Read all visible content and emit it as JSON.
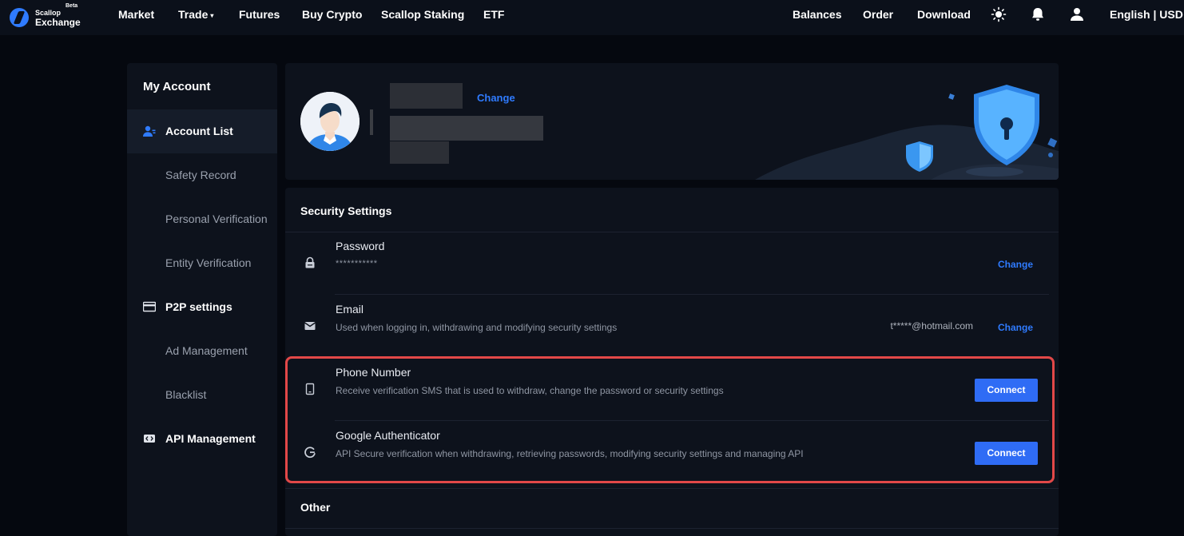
{
  "brand": {
    "name_top": "Scallop",
    "name_main": "Exchange",
    "badge": "Beta"
  },
  "nav": {
    "left": [
      "Market",
      "Trade",
      "Futures",
      "Buy Crypto",
      "Scallop Staking",
      "ETF"
    ],
    "trade_caret": "▾",
    "right": [
      "Balances",
      "Order",
      "Download"
    ],
    "locale": "English | USD",
    "icons": [
      "sun-icon",
      "bell-icon",
      "user-icon"
    ]
  },
  "sidebar": {
    "title": "My Account",
    "items": [
      {
        "label": "Account List",
        "icon": "user-icon",
        "active": true,
        "level": "section"
      },
      {
        "label": "Safety Record",
        "level": "sub"
      },
      {
        "label": "Personal Verification",
        "level": "sub"
      },
      {
        "label": "Entity Verification",
        "level": "sub"
      },
      {
        "label": "P2P settings",
        "icon": "card-icon",
        "level": "section"
      },
      {
        "label": "Ad Management",
        "level": "sub"
      },
      {
        "label": "Blacklist",
        "level": "sub"
      },
      {
        "label": "API Management",
        "icon": "api-icon",
        "level": "section"
      }
    ]
  },
  "profile": {
    "change_label": "Change"
  },
  "security": {
    "title": "Security Settings",
    "rows": [
      {
        "title": "Password",
        "secondary": "***********",
        "icon": "lock-icon",
        "action": "Change"
      },
      {
        "title": "Email",
        "secondary": "Used when logging in, withdrawing and modifying security settings",
        "value": "t*****@hotmail.com",
        "icon": "mail-icon",
        "action": "Change"
      },
      {
        "title": "Phone Number",
        "secondary": "Receive verification SMS that is used to withdraw, change the password or security settings",
        "icon": "phone-icon",
        "action": "Connect"
      },
      {
        "title": "Google Authenticator",
        "secondary": "API Secure verification when withdrawing, retrieving passwords, modifying security settings and managing API",
        "icon": "google-icon",
        "action": "Connect"
      }
    ],
    "other_title": "Other"
  },
  "colors": {
    "accent": "#2f7bff",
    "button": "#2f6cf5",
    "highlight": "#e24848",
    "panel": "#0d121c"
  }
}
